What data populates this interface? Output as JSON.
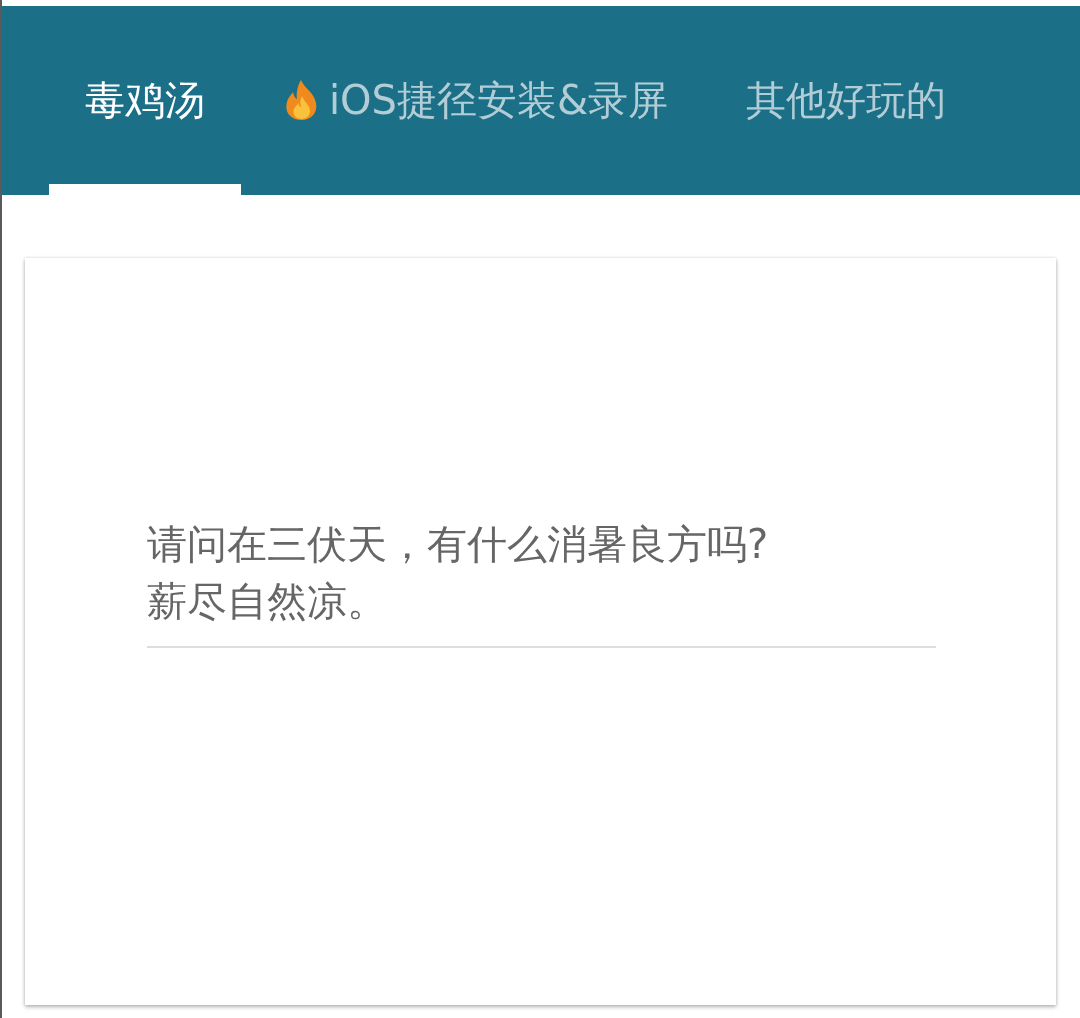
{
  "tabs": [
    {
      "label": "毒鸡汤",
      "selected": true,
      "kind": "plain"
    },
    {
      "label": "iOS捷径安装&录屏",
      "selected": false,
      "kind": "hot"
    },
    {
      "label": "其他好玩的",
      "selected": false,
      "kind": "plain"
    }
  ],
  "quote": {
    "lines": [
      "请问在三伏天，有什么消暑良方吗?",
      "薪尽自然凉。"
    ]
  }
}
